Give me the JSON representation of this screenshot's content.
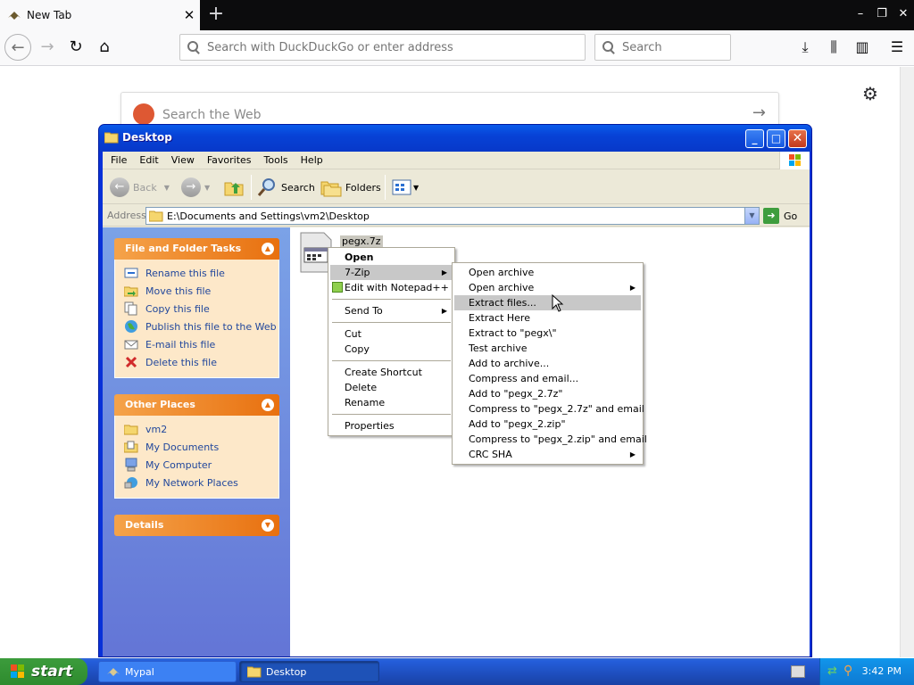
{
  "browser": {
    "tab_title": "New Tab",
    "url_placeholder": "Search with DuckDuckGo or enter address",
    "search_placeholder": "Search",
    "ddg_placeholder": "Search the Web"
  },
  "explorer": {
    "title": "Desktop",
    "menu": [
      "File",
      "Edit",
      "View",
      "Favorites",
      "Tools",
      "Help"
    ],
    "toolbar": {
      "back": "Back",
      "search": "Search",
      "folders": "Folders"
    },
    "address_label": "Address",
    "address": "E:\\Documents and Settings\\vm2\\Desktop",
    "go": "Go",
    "tasks": {
      "file_folder_tasks": {
        "title": "File and Folder Tasks",
        "items": [
          "Rename this file",
          "Move this file",
          "Copy this file",
          "Publish this file to the Web",
          "E-mail this file",
          "Delete this file"
        ]
      },
      "other_places": {
        "title": "Other Places",
        "items": [
          "vm2",
          "My Documents",
          "My Computer",
          "My Network Places"
        ]
      },
      "details": {
        "title": "Details"
      }
    },
    "file": {
      "name": "pegx.7z"
    }
  },
  "context_menu": {
    "open": "Open",
    "seven_zip": "7-Zip",
    "edit_notepad": "Edit with Notepad++",
    "send_to": "Send To",
    "cut": "Cut",
    "copy": "Copy",
    "create_shortcut": "Create Shortcut",
    "delete": "Delete",
    "rename": "Rename",
    "properties": "Properties"
  },
  "submenu": [
    "Open archive",
    "Open archive",
    "Extract files...",
    "Extract Here",
    "Extract to \"pegx\\\"",
    "Test archive",
    "Add to archive...",
    "Compress and email...",
    "Add to \"pegx_2.7z\"",
    "Compress to \"pegx_2.7z\" and email",
    "Add to \"pegx_2.zip\"",
    "Compress to \"pegx_2.zip\" and email",
    "CRC SHA"
  ],
  "taskbar": {
    "start": "start",
    "tasks": [
      "Mypal",
      "Desktop"
    ],
    "time": "3:42 PM"
  }
}
